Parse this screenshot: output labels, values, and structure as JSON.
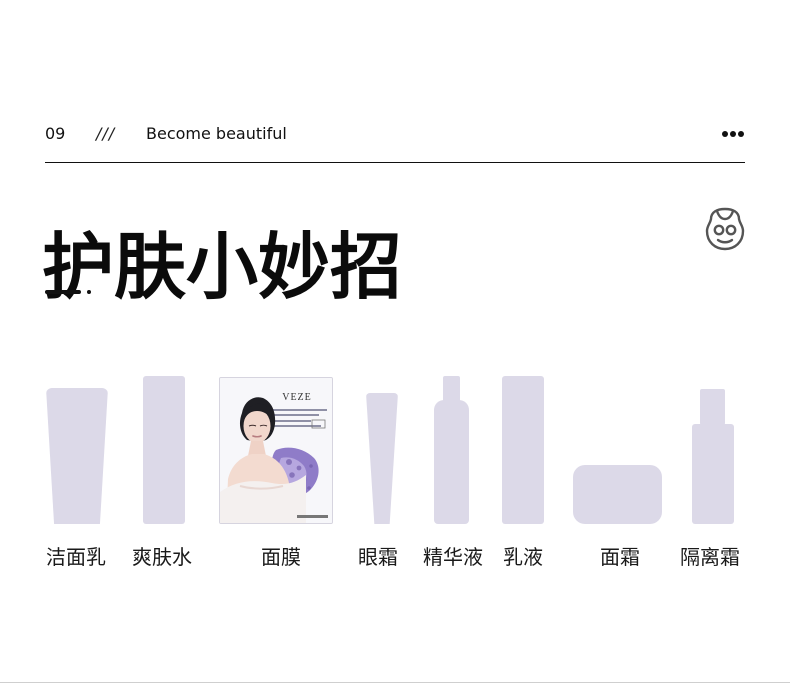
{
  "header": {
    "section_number": "09",
    "divider": "///",
    "subtitle": "Become beautiful",
    "more_icon": "more-horizontal-icon"
  },
  "title": {
    "text": "护肤小妙招",
    "icon": "face-mask-icon"
  },
  "product_mask": {
    "brand": "VEZE"
  },
  "products": [
    {
      "label": "洁面乳",
      "icon": "cleanser-tube-icon"
    },
    {
      "label": "爽肤水",
      "icon": "toner-bottle-icon"
    },
    {
      "label": "面膜",
      "icon": "face-mask-package-icon"
    },
    {
      "label": "眼霜",
      "icon": "eye-cream-tube-icon"
    },
    {
      "label": "精华液",
      "icon": "serum-bottle-icon"
    },
    {
      "label": "乳液",
      "icon": "lotion-bottle-icon"
    },
    {
      "label": "面霜",
      "icon": "cream-jar-icon"
    },
    {
      "label": "隔离霜",
      "icon": "primer-bottle-icon"
    }
  ],
  "colors": {
    "product_shape": "#dcd9e8",
    "text": "#111111",
    "accent": "#111111",
    "mask_purple": "#8f7cc8"
  }
}
